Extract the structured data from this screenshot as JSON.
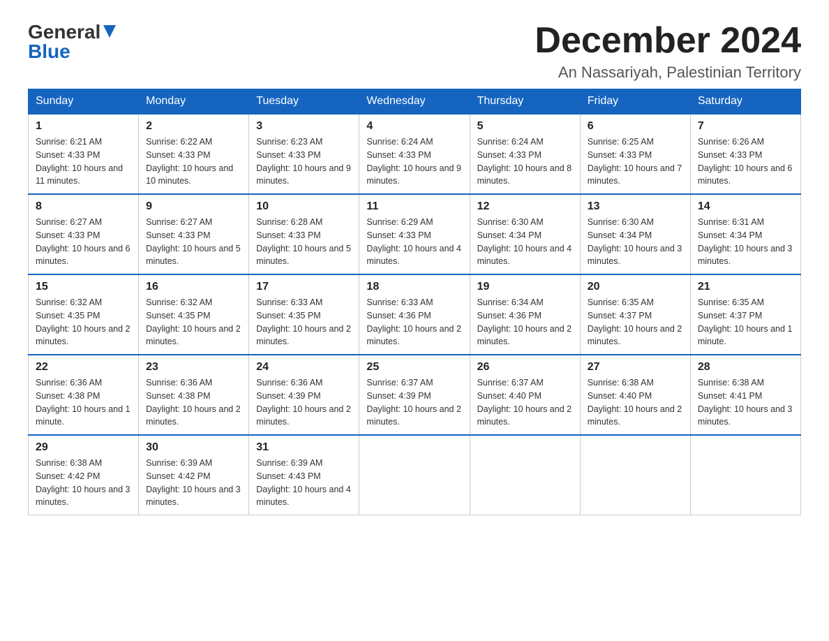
{
  "header": {
    "logo_general": "General",
    "logo_blue": "Blue",
    "title": "December 2024",
    "subtitle": "An Nassariyah, Palestinian Territory"
  },
  "days_of_week": [
    "Sunday",
    "Monday",
    "Tuesday",
    "Wednesday",
    "Thursday",
    "Friday",
    "Saturday"
  ],
  "weeks": [
    [
      {
        "day": "1",
        "sunrise": "6:21 AM",
        "sunset": "4:33 PM",
        "daylight": "10 hours and 11 minutes."
      },
      {
        "day": "2",
        "sunrise": "6:22 AM",
        "sunset": "4:33 PM",
        "daylight": "10 hours and 10 minutes."
      },
      {
        "day": "3",
        "sunrise": "6:23 AM",
        "sunset": "4:33 PM",
        "daylight": "10 hours and 9 minutes."
      },
      {
        "day": "4",
        "sunrise": "6:24 AM",
        "sunset": "4:33 PM",
        "daylight": "10 hours and 9 minutes."
      },
      {
        "day": "5",
        "sunrise": "6:24 AM",
        "sunset": "4:33 PM",
        "daylight": "10 hours and 8 minutes."
      },
      {
        "day": "6",
        "sunrise": "6:25 AM",
        "sunset": "4:33 PM",
        "daylight": "10 hours and 7 minutes."
      },
      {
        "day": "7",
        "sunrise": "6:26 AM",
        "sunset": "4:33 PM",
        "daylight": "10 hours and 6 minutes."
      }
    ],
    [
      {
        "day": "8",
        "sunrise": "6:27 AM",
        "sunset": "4:33 PM",
        "daylight": "10 hours and 6 minutes."
      },
      {
        "day": "9",
        "sunrise": "6:27 AM",
        "sunset": "4:33 PM",
        "daylight": "10 hours and 5 minutes."
      },
      {
        "day": "10",
        "sunrise": "6:28 AM",
        "sunset": "4:33 PM",
        "daylight": "10 hours and 5 minutes."
      },
      {
        "day": "11",
        "sunrise": "6:29 AM",
        "sunset": "4:33 PM",
        "daylight": "10 hours and 4 minutes."
      },
      {
        "day": "12",
        "sunrise": "6:30 AM",
        "sunset": "4:34 PM",
        "daylight": "10 hours and 4 minutes."
      },
      {
        "day": "13",
        "sunrise": "6:30 AM",
        "sunset": "4:34 PM",
        "daylight": "10 hours and 3 minutes."
      },
      {
        "day": "14",
        "sunrise": "6:31 AM",
        "sunset": "4:34 PM",
        "daylight": "10 hours and 3 minutes."
      }
    ],
    [
      {
        "day": "15",
        "sunrise": "6:32 AM",
        "sunset": "4:35 PM",
        "daylight": "10 hours and 2 minutes."
      },
      {
        "day": "16",
        "sunrise": "6:32 AM",
        "sunset": "4:35 PM",
        "daylight": "10 hours and 2 minutes."
      },
      {
        "day": "17",
        "sunrise": "6:33 AM",
        "sunset": "4:35 PM",
        "daylight": "10 hours and 2 minutes."
      },
      {
        "day": "18",
        "sunrise": "6:33 AM",
        "sunset": "4:36 PM",
        "daylight": "10 hours and 2 minutes."
      },
      {
        "day": "19",
        "sunrise": "6:34 AM",
        "sunset": "4:36 PM",
        "daylight": "10 hours and 2 minutes."
      },
      {
        "day": "20",
        "sunrise": "6:35 AM",
        "sunset": "4:37 PM",
        "daylight": "10 hours and 2 minutes."
      },
      {
        "day": "21",
        "sunrise": "6:35 AM",
        "sunset": "4:37 PM",
        "daylight": "10 hours and 1 minute."
      }
    ],
    [
      {
        "day": "22",
        "sunrise": "6:36 AM",
        "sunset": "4:38 PM",
        "daylight": "10 hours and 1 minute."
      },
      {
        "day": "23",
        "sunrise": "6:36 AM",
        "sunset": "4:38 PM",
        "daylight": "10 hours and 2 minutes."
      },
      {
        "day": "24",
        "sunrise": "6:36 AM",
        "sunset": "4:39 PM",
        "daylight": "10 hours and 2 minutes."
      },
      {
        "day": "25",
        "sunrise": "6:37 AM",
        "sunset": "4:39 PM",
        "daylight": "10 hours and 2 minutes."
      },
      {
        "day": "26",
        "sunrise": "6:37 AM",
        "sunset": "4:40 PM",
        "daylight": "10 hours and 2 minutes."
      },
      {
        "day": "27",
        "sunrise": "6:38 AM",
        "sunset": "4:40 PM",
        "daylight": "10 hours and 2 minutes."
      },
      {
        "day": "28",
        "sunrise": "6:38 AM",
        "sunset": "4:41 PM",
        "daylight": "10 hours and 3 minutes."
      }
    ],
    [
      {
        "day": "29",
        "sunrise": "6:38 AM",
        "sunset": "4:42 PM",
        "daylight": "10 hours and 3 minutes."
      },
      {
        "day": "30",
        "sunrise": "6:39 AM",
        "sunset": "4:42 PM",
        "daylight": "10 hours and 3 minutes."
      },
      {
        "day": "31",
        "sunrise": "6:39 AM",
        "sunset": "4:43 PM",
        "daylight": "10 hours and 4 minutes."
      },
      null,
      null,
      null,
      null
    ]
  ]
}
